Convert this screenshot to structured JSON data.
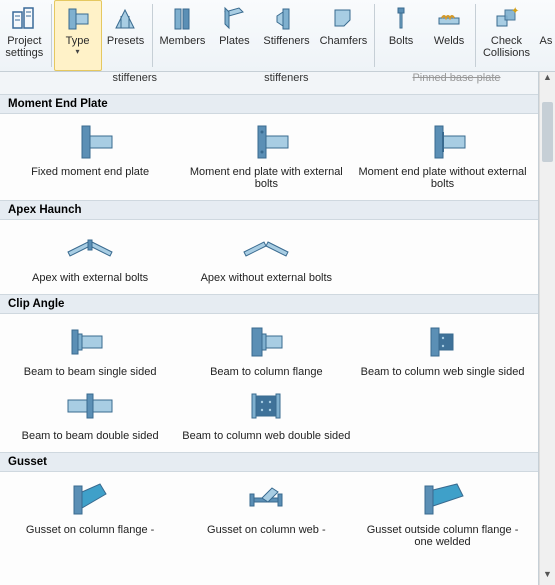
{
  "ribbon": {
    "project_settings": "Project\nsettings",
    "type": "Type",
    "presets": "Presets",
    "members": "Members",
    "plates": "Plates",
    "stiffeners": "Stiffeners",
    "chamfers": "Chamfers",
    "bolts": "Bolts",
    "welds": "Welds",
    "check_collisions": "Check\nCollisions",
    "as_partial": "As"
  },
  "top_row": {
    "left": "stiffeners",
    "mid": "stiffeners",
    "right": "Pinned base plate"
  },
  "sections": {
    "moment_end_plate": {
      "header": "Moment End Plate",
      "items": [
        "Fixed moment end plate",
        "Moment end plate with external bolts",
        "Moment end plate without external bolts"
      ]
    },
    "apex_haunch": {
      "header": "Apex Haunch",
      "items": [
        "Apex with external bolts",
        "Apex without external bolts"
      ]
    },
    "clip_angle": {
      "header": "Clip Angle",
      "items": [
        "Beam to beam single sided",
        "Beam to column flange",
        "Beam to column web single sided",
        "Beam to beam double sided",
        "Beam to column web double sided"
      ]
    },
    "gusset": {
      "header": "Gusset",
      "items": [
        "Gusset on column flange -",
        "Gusset on column web -",
        "Gusset outside column flange - one welded"
      ]
    }
  }
}
